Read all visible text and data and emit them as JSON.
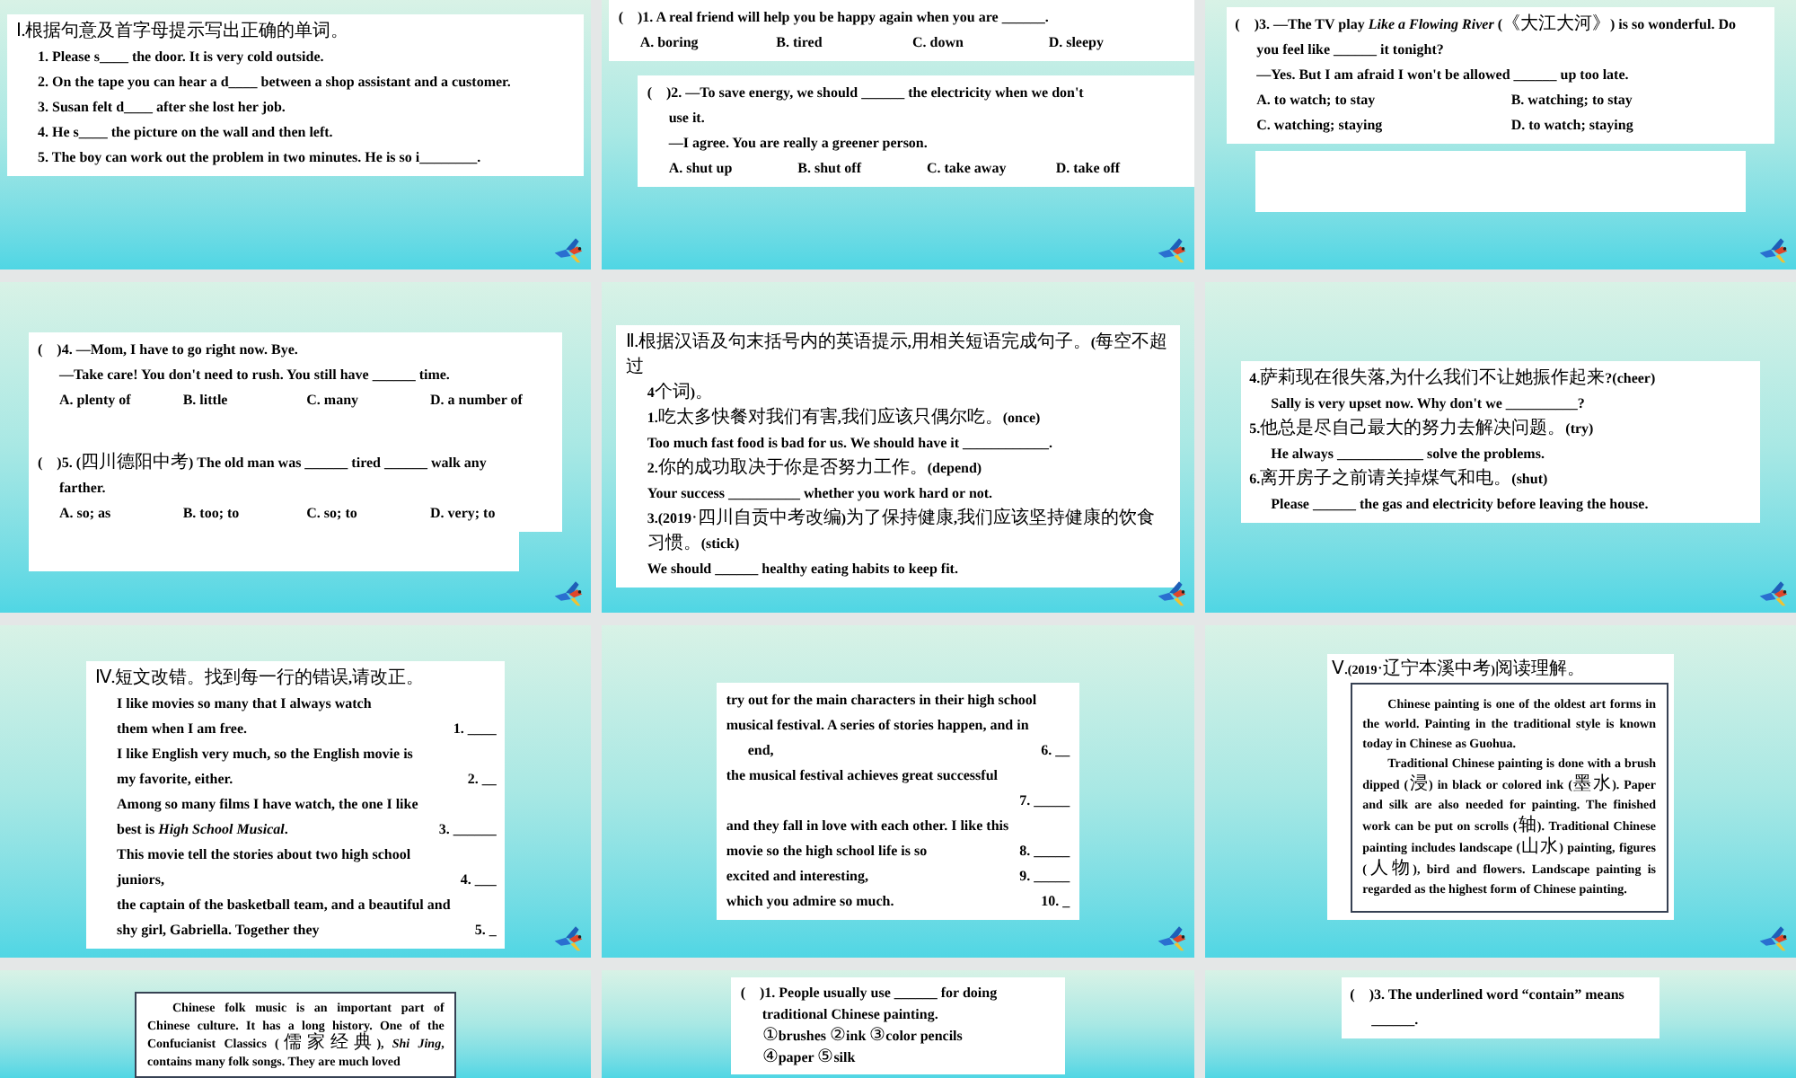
{
  "slides": [
    {
      "blocks": [
        {
          "kind": "lines",
          "lines": [
            {
              "kind": "text",
              "indent": false,
              "text": "Ⅰ.根据句意及首字母提示写出正确的单词。"
            },
            {
              "kind": "text",
              "indent": true,
              "text": "1. Please s____ the door. It is very cold outside."
            },
            {
              "kind": "text",
              "indent": true,
              "text": "2. On the tape you can hear a d____ between a shop assistant and a customer."
            },
            {
              "kind": "text",
              "indent": true,
              "text": "3. Susan felt d____ after she lost her job."
            },
            {
              "kind": "text",
              "indent": true,
              "text": "4. He s____ the picture on the wall and then left."
            },
            {
              "kind": "text",
              "indent": true,
              "text": "5. The boy can work out the problem in two minutes. He is so i________."
            }
          ]
        }
      ]
    },
    {
      "blocks": [
        {
          "kind": "lines",
          "lines": [
            {
              "kind": "text",
              "indent": false,
              "text": "(    )1. A real friend will help you be happy again when you are ______."
            },
            {
              "kind": "options",
              "indent": true,
              "options": [
                "A. boring",
                "B. tired",
                "C. down",
                "D. sleepy"
              ]
            }
          ]
        },
        {
          "kind": "lines",
          "lines": [
            {
              "kind": "text",
              "indent": false,
              "text": "(    )2. —To save energy, we should ______ the electricity when we don't"
            },
            {
              "kind": "text",
              "indent": true,
              "text": "use it."
            },
            {
              "kind": "text",
              "indent": true,
              "text": "—I agree. You are really a greener person."
            },
            {
              "kind": "options",
              "indent": true,
              "options": [
                "A. shut up",
                "B. shut off",
                "C. take away",
                "D. take off"
              ]
            }
          ]
        }
      ]
    },
    {
      "blocks": [
        {
          "kind": "lines",
          "lines": [
            {
              "kind": "text",
              "indent": false,
              "text": "(    )3. —The TV play *Like a Flowing River* (《大江大河》) is so wonderful. Do"
            },
            {
              "kind": "text",
              "indent": true,
              "text": "you feel like ______ it tonight?"
            },
            {
              "kind": "text",
              "indent": true,
              "text": "—Yes. But I am afraid I won't be allowed ______ up too late."
            },
            {
              "kind": "options",
              "indent": true,
              "options": [
                "A. to watch; to stay",
                "B. watching; to stay"
              ]
            },
            {
              "kind": "options",
              "indent": true,
              "options": [
                "C. watching; staying",
                "D. to watch; staying"
              ]
            }
          ]
        },
        {
          "kind": "blank"
        }
      ]
    },
    {
      "blocks": [
        {
          "kind": "lines",
          "lines": [
            {
              "kind": "text",
              "indent": false,
              "text": "(    )4. —Mom, I have to go right now. Bye."
            },
            {
              "kind": "text",
              "indent": true,
              "text": "—Take care! You don't need to rush. You still have ______ time."
            },
            {
              "kind": "options",
              "indent": true,
              "options": [
                "A. plenty of",
                "B. little",
                "C. many",
                "D. a number of"
              ]
            }
          ]
        },
        {
          "kind": "blank"
        },
        {
          "kind": "lines",
          "lines": [
            {
              "kind": "text",
              "indent": false,
              "text": "(    )5. (四川德阳中考) The old man was ______ tired ______ walk any"
            },
            {
              "kind": "text",
              "indent": true,
              "text": "farther."
            },
            {
              "kind": "options",
              "indent": true,
              "options": [
                "A. so; as",
                "B. too; to",
                "C. so; to",
                "D. very; to"
              ]
            }
          ]
        },
        {
          "kind": "blank"
        }
      ]
    },
    {
      "blocks": [
        {
          "kind": "lines",
          "lines": [
            {
              "kind": "text",
              "indent": false,
              "text": "Ⅱ.根据汉语及句末括号内的英语提示,用相关短语完成句子。(每空不超过"
            },
            {
              "kind": "text",
              "indent": true,
              "text": "4个词)。"
            },
            {
              "kind": "text",
              "indent": true,
              "text": "1.吃太多快餐对我们有害,我们应该只偶尔吃。(once)"
            },
            {
              "kind": "text",
              "indent": true,
              "text": "Too much fast food is bad for us. We should have it ____________."
            },
            {
              "kind": "text",
              "indent": true,
              "text": "2.你的成功取决于你是否努力工作。(depend)"
            },
            {
              "kind": "text",
              "indent": true,
              "text": "Your success __________ whether you work hard or not."
            },
            {
              "kind": "text",
              "indent": true,
              "text": "3.(2019·四川自贡中考改编)为了保持健康,我们应该坚持健康的饮食"
            },
            {
              "kind": "text",
              "indent": true,
              "text": "习惯。(stick)"
            },
            {
              "kind": "text",
              "indent": true,
              "text": "We should ______ healthy eating habits to keep fit."
            }
          ]
        }
      ]
    },
    {
      "blocks": [
        {
          "kind": "lines",
          "lines": [
            {
              "kind": "text",
              "indent": false,
              "text": "4.萨莉现在很失落,为什么我们不让她振作起来?(cheer)"
            },
            {
              "kind": "text",
              "indent": true,
              "text": "Sally is very upset now. Why don't we __________?"
            },
            {
              "kind": "text",
              "indent": false,
              "text": "5.他总是尽自己最大的努力去解决问题。(try)"
            },
            {
              "kind": "text",
              "indent": true,
              "text": "He always ____________ solve the problems."
            },
            {
              "kind": "text",
              "indent": false,
              "text": "6.离开房子之前请关掉煤气和电。(shut)"
            },
            {
              "kind": "text",
              "indent": true,
              "text": "Please ______ the gas and electricity before leaving the house."
            }
          ]
        }
      ]
    },
    {
      "blocks": [
        {
          "kind": "lines",
          "lines": [
            {
              "kind": "text",
              "indent": false,
              "text": "Ⅳ.短文改错。找到每一行的错误,请改正。"
            },
            {
              "kind": "text",
              "indent": true,
              "text": "I like movies so many that I always watch"
            },
            {
              "kind": "numbered",
              "indent": true,
              "text": "them when I am free.",
              "number": "1. ____"
            },
            {
              "kind": "text",
              "indent": true,
              "text": "I like English very much, so the English movie is"
            },
            {
              "kind": "numbered",
              "indent": true,
              "text": "my favorite, either.",
              "number": "2. __"
            },
            {
              "kind": "text",
              "indent": true,
              "text": "Among so many films I have watch, the one I like"
            },
            {
              "kind": "numbered",
              "indent": true,
              "text": "best is *High School Musical*.",
              "number": "3. ______"
            },
            {
              "kind": "text",
              "indent": true,
              "text": "This movie tell the stories about two high school"
            },
            {
              "kind": "numbered",
              "indent": true,
              "text": "juniors,",
              "number": "4. ___"
            },
            {
              "kind": "text",
              "indent": true,
              "text": "the captain of the basketball team, and a beautiful and"
            },
            {
              "kind": "numbered",
              "indent": true,
              "text": "shy girl, Gabriella. Together they",
              "number": "5. _"
            }
          ]
        }
      ]
    },
    {
      "blocks": [
        {
          "kind": "lines",
          "lines": [
            {
              "kind": "text",
              "indent": false,
              "text": "try out for the main characters in their high school"
            },
            {
              "kind": "text",
              "indent": false,
              "text": "musical festival. A series of stories happen, and in"
            },
            {
              "kind": "numbered",
              "indent": true,
              "text": "end,",
              "number": "6. __"
            },
            {
              "kind": "text",
              "indent": false,
              "text": "the musical festival achieves great successful"
            },
            {
              "kind": "numbered",
              "number": "7. _____"
            },
            {
              "kind": "text",
              "indent": false,
              "text": "and they fall in love with each other. I like this"
            },
            {
              "kind": "numbered",
              "indent": false,
              "text": "movie so the high school life is so",
              "number": "8. _____"
            },
            {
              "kind": "numbered",
              "indent": false,
              "text": "excited and interesting,",
              "number": "9. _____"
            },
            {
              "kind": "numbered",
              "indent": false,
              "text": "which you admire so much.",
              "number": "10. _"
            }
          ]
        }
      ]
    },
    {
      "blocks": [
        {
          "kind": "passage",
          "heading": "Ⅴ.(2019·辽宁本溪中考)阅读理解。",
          "paragraphs": [
            "Chinese painting is one of the oldest art forms in the world. Painting in the traditional style is known today in Chinese as Guohua.",
            "Traditional Chinese painting is done with a brush dipped (浸) in black or colored ink (墨水). Paper and silk are also needed for painting. The finished work can be put on scrolls (轴). Traditional Chinese painting includes landscape (山水) painting, figures (人物), bird and flowers. Landscape painting is regarded as the highest form of Chinese painting."
          ]
        }
      ]
    },
    {
      "blocks": [
        {
          "kind": "passage",
          "paragraphs": [
            "Chinese folk music is an important part of Chinese culture. It has a long history. One of the Confucianist Classics (儒家经典), *Shi Jing*, contains many folk songs. They are much loved"
          ]
        }
      ]
    },
    {
      "blocks": [
        {
          "kind": "lines",
          "lines": [
            {
              "kind": "text",
              "indent": false,
              "text": "(    )1. People usually use ______ for doing"
            },
            {
              "kind": "text",
              "indent": true,
              "text": "traditional Chinese painting."
            },
            {
              "kind": "text",
              "indent": true,
              "text": "①brushes ②ink ③color pencils"
            },
            {
              "kind": "text",
              "indent": true,
              "text": "④paper ⑤silk"
            }
          ]
        }
      ]
    },
    {
      "blocks": [
        {
          "kind": "lines",
          "lines": [
            {
              "kind": "text",
              "indent": false,
              "text": "(    )3. The underlined word “contain” means"
            },
            {
              "kind": "text",
              "indent": true,
              "text": "______."
            }
          ]
        }
      ]
    }
  ]
}
